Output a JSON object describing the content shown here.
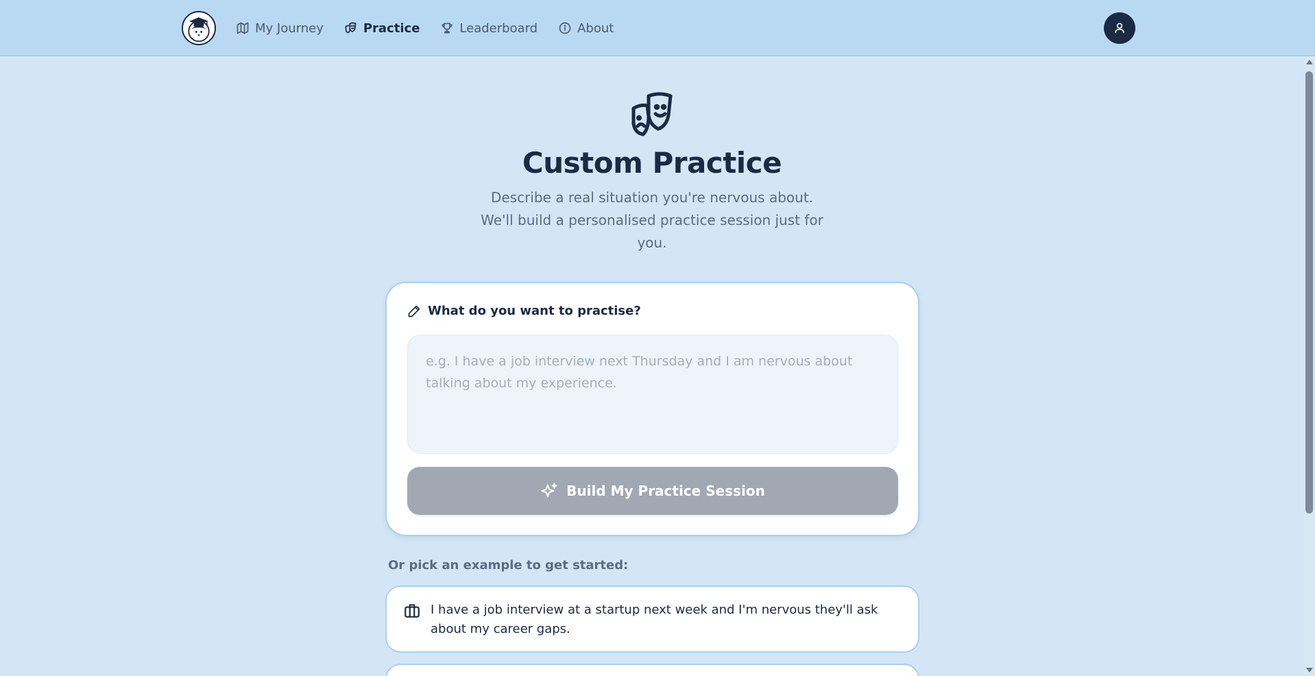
{
  "nav": {
    "logo_icon": "graduate-penguin-logo",
    "items": [
      {
        "label": "My Journey",
        "icon": "map-icon",
        "active": false
      },
      {
        "label": "Practice",
        "icon": "theater-masks-icon",
        "active": true
      },
      {
        "label": "Leaderboard",
        "icon": "trophy-icon",
        "active": false
      },
      {
        "label": "About",
        "icon": "info-icon",
        "active": false
      }
    ],
    "profile_icon": "user-icon"
  },
  "hero": {
    "icon": "theater-masks-icon",
    "title": "Custom Practice",
    "subtitle": "Describe a real situation you're nervous about. We'll build a personalised practice session just for you."
  },
  "form": {
    "label": "What do you want to practise?",
    "label_icon": "pencil-icon",
    "placeholder": "e.g. I have a job interview next Thursday and I am nervous about talking about my experience.",
    "value": "",
    "button_label": "Build My Practice Session",
    "button_icon": "sparkles-icon",
    "button_disabled": true
  },
  "examples": {
    "heading": "Or pick an example to get started:",
    "items": [
      {
        "icon": "briefcase-icon",
        "text": "I have a job interview at a startup next week and I'm nervous they'll ask about my career gaps."
      },
      {
        "icon": "",
        "text": ""
      }
    ]
  },
  "colors": {
    "header_bg": "#b8d9f1",
    "page_bg": "#d4e6f5",
    "primary_dark": "#1b2a44",
    "disabled_button": "#a1a8b3",
    "card_border": "#a9d0ee"
  }
}
